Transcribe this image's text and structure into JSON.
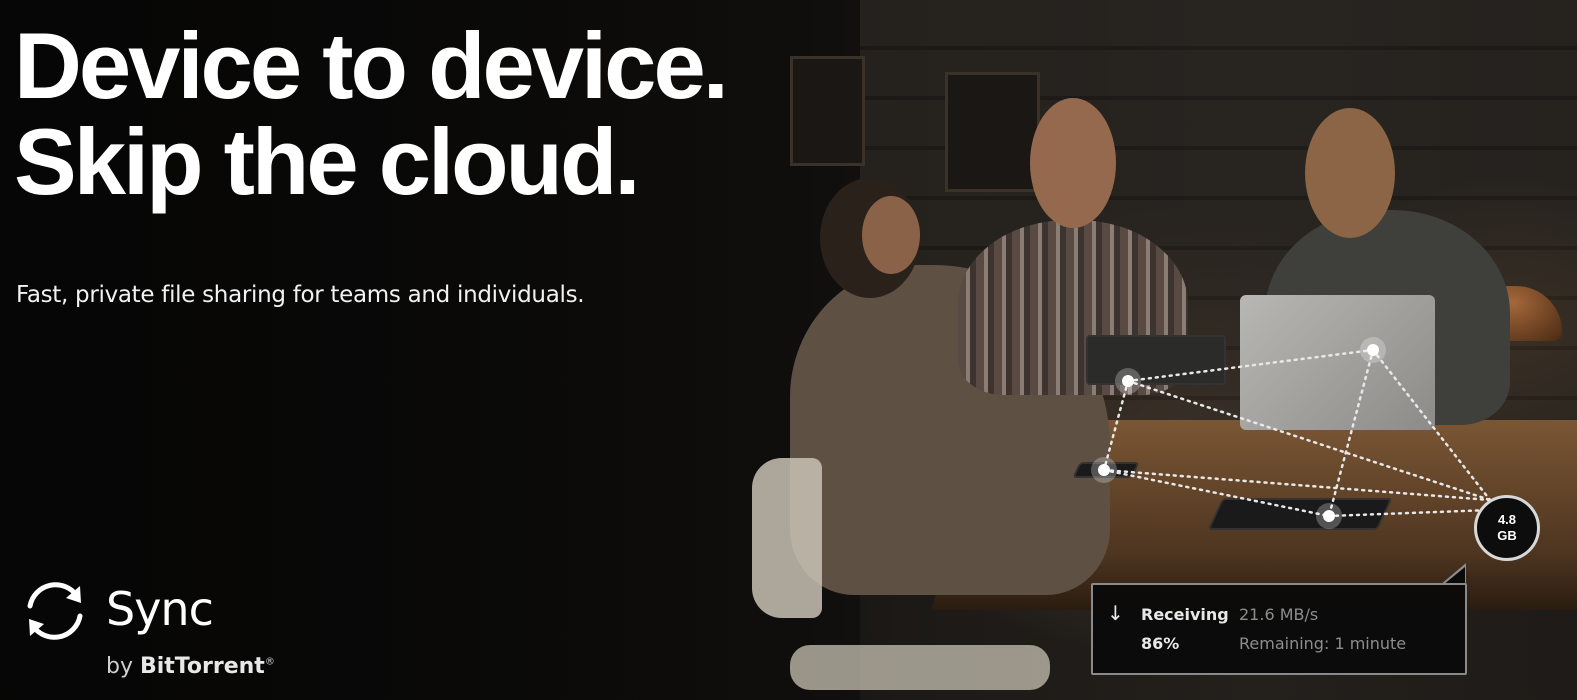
{
  "hero": {
    "headline_line1": "Device to device.",
    "headline_line2": "Skip the cloud.",
    "subheadline": "Fast, private file sharing for teams and individuals."
  },
  "logo": {
    "icon": "sync-arrows-icon",
    "name": "Sync",
    "by": "by",
    "brand": "BitTorrent",
    "trademark": "®"
  },
  "transfer": {
    "icon": "arrow-down-icon",
    "status_label": "Receiving",
    "rate": "21.6 MB/s",
    "percent": "86%",
    "remaining": "Remaining: 1 minute",
    "progress": 0.86
  },
  "badge": {
    "size": "4.8\nGB"
  },
  "colors": {
    "background": "#0b0a09",
    "text": "#ffffff",
    "muted_text": "#8d8d8d",
    "box_border": "#8a8a8a"
  }
}
